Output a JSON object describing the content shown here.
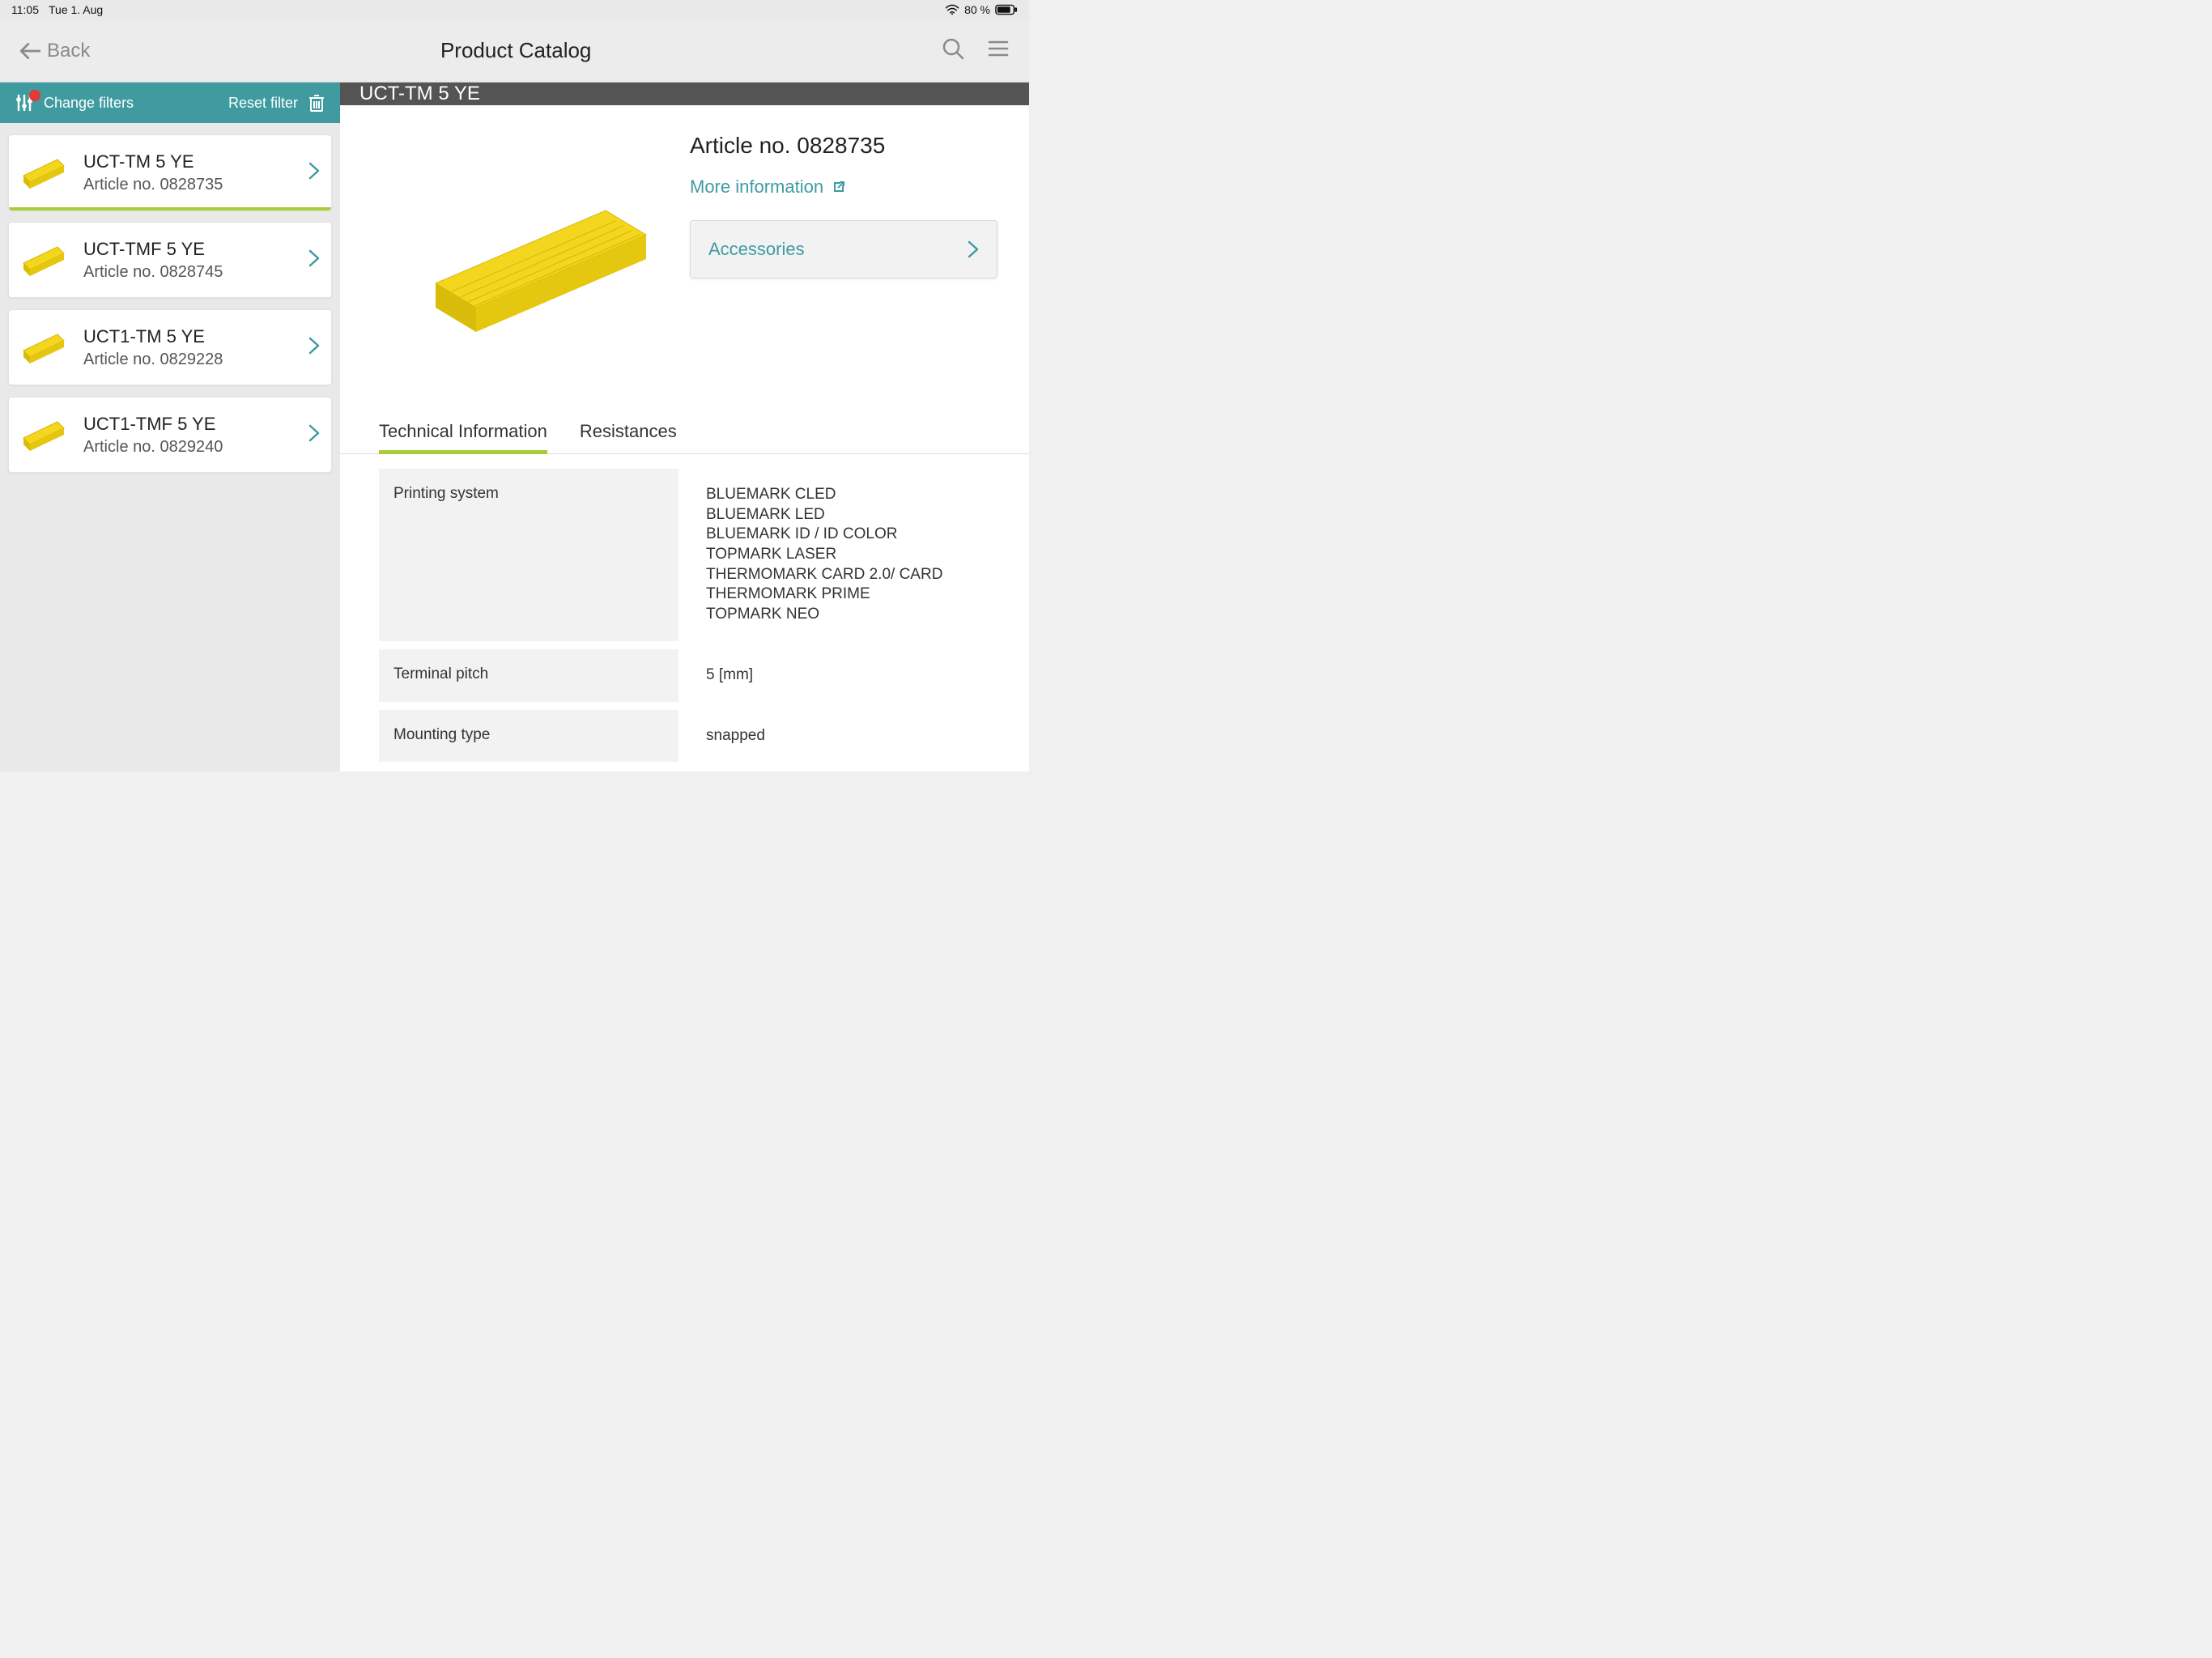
{
  "status": {
    "time": "11:05",
    "date": "Tue 1. Aug",
    "battery": "80 %"
  },
  "nav": {
    "back": "Back",
    "title": "Product Catalog"
  },
  "filter": {
    "change": "Change filters",
    "reset": "Reset filter"
  },
  "products": [
    {
      "title": "UCT-TM 5 YE",
      "sub": "Article no. 0828735",
      "selected": true
    },
    {
      "title": "UCT-TMF 5 YE",
      "sub": "Article no. 0828745",
      "selected": false
    },
    {
      "title": "UCT1-TM 5 YE",
      "sub": "Article no. 0829228",
      "selected": false
    },
    {
      "title": "UCT1-TMF 5 YE",
      "sub": "Article no. 0829240",
      "selected": false
    }
  ],
  "detail": {
    "header": "UCT-TM 5 YE",
    "article": "Article no. 0828735",
    "more_info": "More information",
    "accessories": "Accessories",
    "tabs": {
      "tech": "Technical Information",
      "resist": "Resistances"
    },
    "tech": [
      {
        "key": "Printing system",
        "val": [
          "BLUEMARK CLED",
          "BLUEMARK LED",
          "BLUEMARK ID / ID COLOR",
          "TOPMARK LASER",
          "THERMOMARK CARD 2.0/ CARD",
          "THERMOMARK PRIME",
          "TOPMARK NEO"
        ]
      },
      {
        "key": "Terminal pitch",
        "val": [
          "5 [mm]"
        ]
      },
      {
        "key": "Mounting type",
        "val": [
          "snapped"
        ]
      }
    ]
  },
  "colors": {
    "teal": "#3f9ba0",
    "green": "#a6ce39",
    "yellow": "#f4d61f"
  }
}
